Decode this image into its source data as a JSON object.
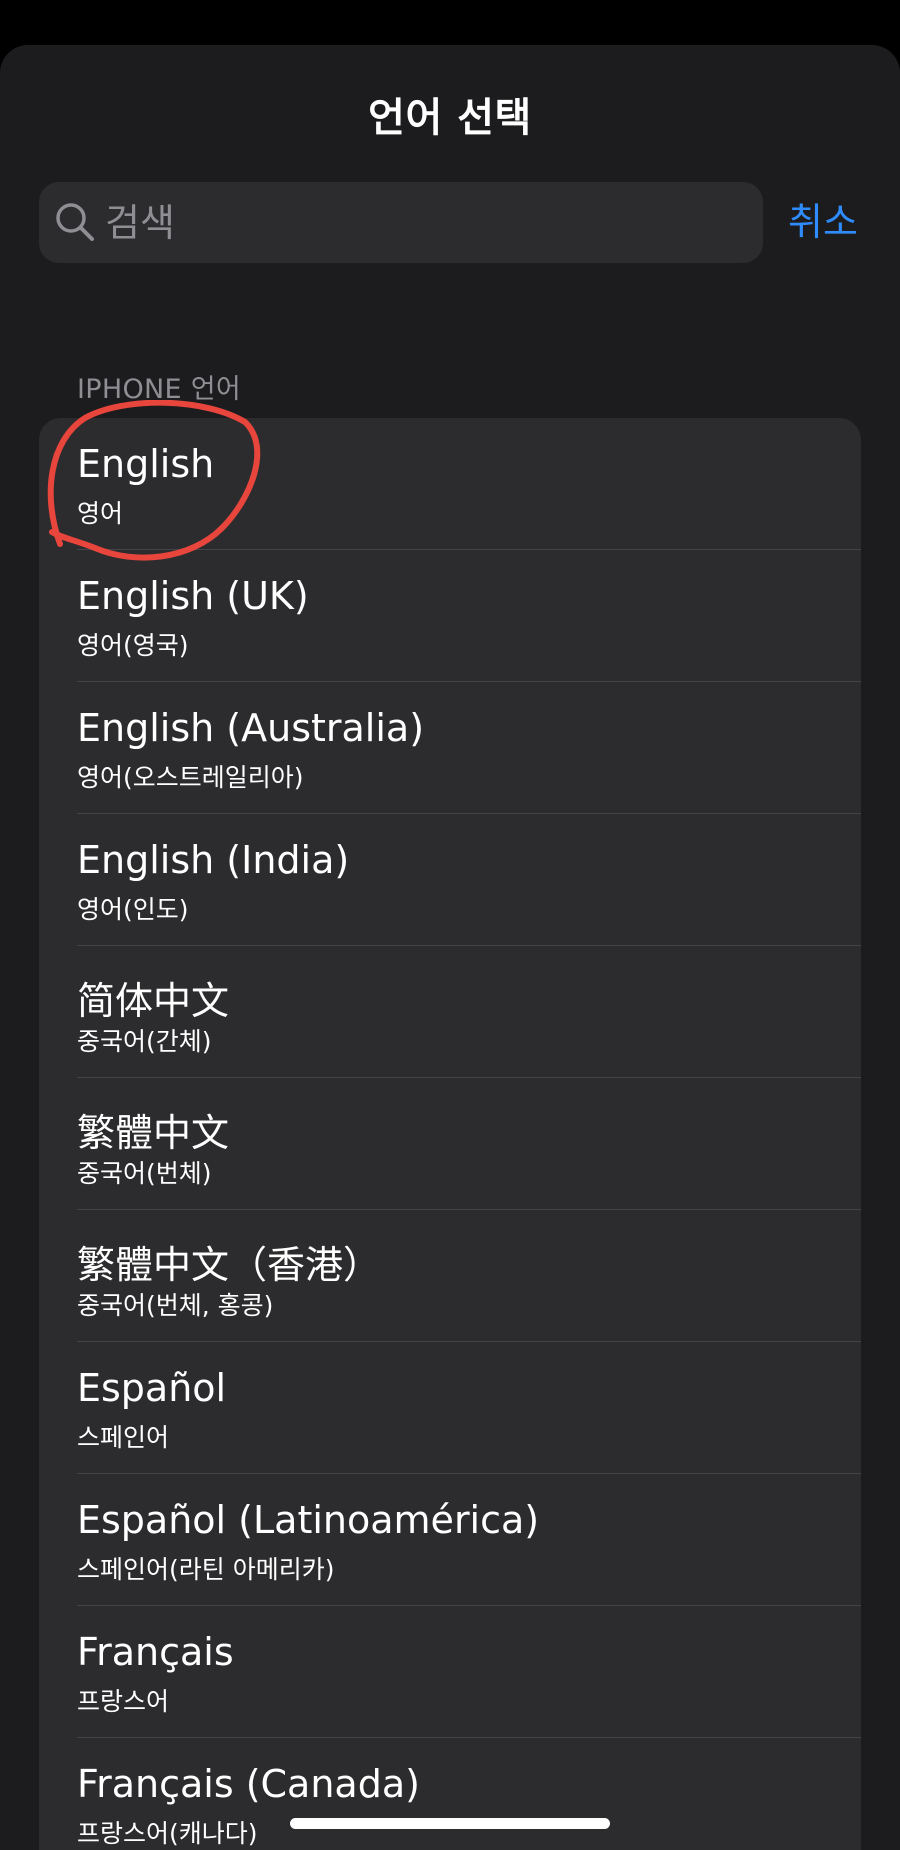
{
  "sheet": {
    "title": "언어 선택"
  },
  "search": {
    "placeholder": "검색",
    "value": "",
    "icon": "search-icon",
    "cancel_label": "취소"
  },
  "section": {
    "header": "IPHONE 언어"
  },
  "languages": [
    {
      "name": "English",
      "subtitle": "영어"
    },
    {
      "name": "English (UK)",
      "subtitle": "영어(영국)"
    },
    {
      "name": "English (Australia)",
      "subtitle": "영어(오스트레일리아)"
    },
    {
      "name": "English (India)",
      "subtitle": "영어(인도)"
    },
    {
      "name": "简体中文",
      "subtitle": "중국어(간체)"
    },
    {
      "name": "繁體中文",
      "subtitle": "중국어(번체)"
    },
    {
      "name": "繁體中文（香港）",
      "subtitle": "중국어(번체, 홍콩)"
    },
    {
      "name": "Español",
      "subtitle": "스페인어"
    },
    {
      "name": "Español (Latinoamérica)",
      "subtitle": "스페인어(라틴 아메리카)"
    },
    {
      "name": "Français",
      "subtitle": "프랑스어"
    },
    {
      "name": "Français (Canada)",
      "subtitle": "프랑스어(캐나다)"
    }
  ],
  "colors": {
    "background": "#000000",
    "sheet": "#1c1c1e",
    "cell": "#2c2c2e",
    "accent": "#2f8cff",
    "secondary_text": "#8e8e93",
    "annotation": "#e8453c"
  }
}
